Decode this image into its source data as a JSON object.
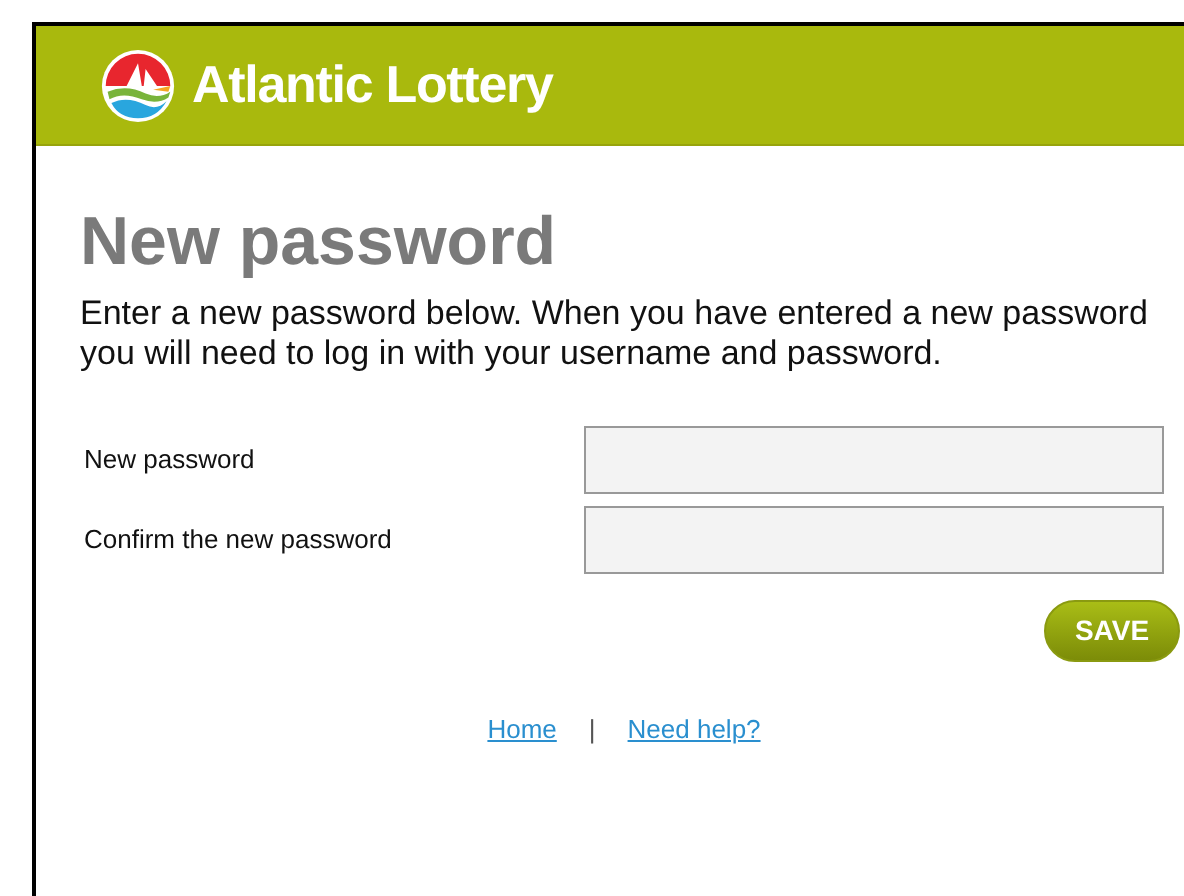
{
  "header": {
    "brand": "Atlantic Lottery"
  },
  "title": "New password",
  "intro": "Enter a new password below. When you have entered a new password you will need to log in with your username and password.",
  "fields": [
    {
      "label": "New password"
    },
    {
      "label": "Confirm the new password"
    }
  ],
  "save_button": "SAVE",
  "footer_links": [
    "Home",
    "Need help?"
  ],
  "separator": "|"
}
